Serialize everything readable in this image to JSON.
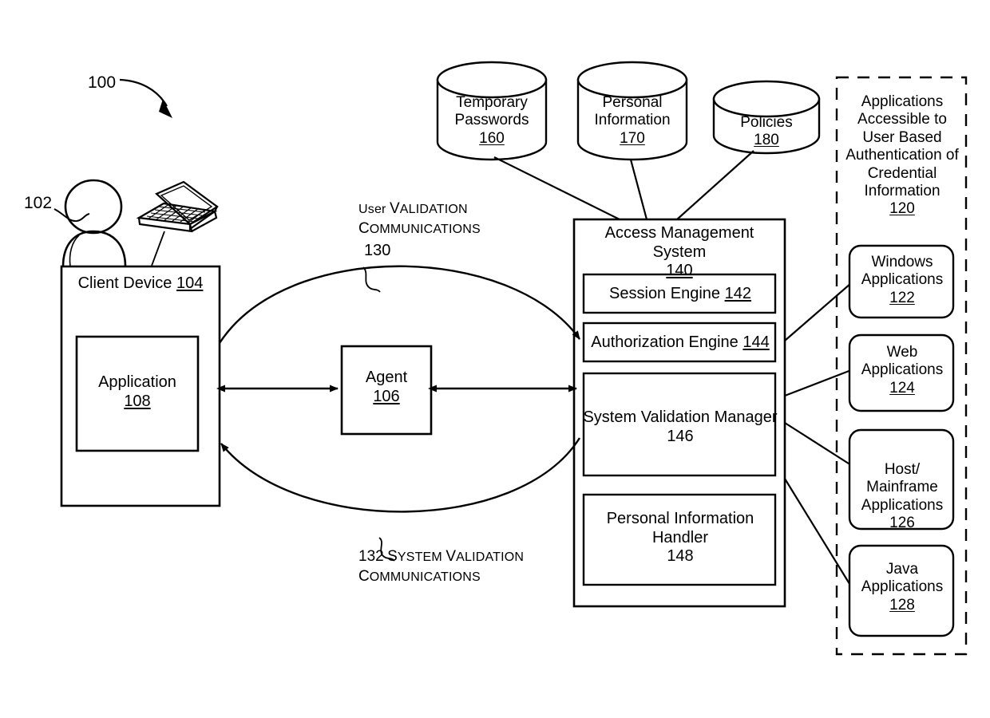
{
  "figure": {
    "number": "100",
    "user_ref": "102"
  },
  "client": {
    "title": "Client Device ",
    "ref": "104",
    "app_name": "Application",
    "app_ref": "108"
  },
  "agent": {
    "name": "Agent",
    "ref": "106"
  },
  "datastores": [
    {
      "name": "Temporary\nPasswords",
      "line1": "Temporary",
      "line2": "Passwords",
      "ref": "160"
    },
    {
      "name": "Personal\nInformation",
      "line1": "Personal",
      "line2": "Information",
      "ref": "170"
    },
    {
      "name": "Policies",
      "line1": "Policies",
      "line2": "",
      "ref": "180"
    }
  ],
  "ams": {
    "title": "Access Management System",
    "ref": "140",
    "components": [
      {
        "label": "Session Engine ",
        "ref": "142",
        "ref_underlined": true
      },
      {
        "label": "Authorization Engine ",
        "ref": "144",
        "ref_underlined": true
      },
      {
        "label": "System Validation Manager",
        "ref": "146",
        "ref_underlined": false
      },
      {
        "label": "Personal Information\nHandler",
        "ref": "148",
        "ref_underlined": false
      }
    ]
  },
  "applications_group": {
    "title": "Applications Accessible to User Based Authentication of Credential Information",
    "ref": "120",
    "items": [
      {
        "label": "Windows\nApplications",
        "ref": "122"
      },
      {
        "label": "Web\nApplications",
        "ref": "124"
      },
      {
        "label": "Host/\nMainframe\nApplications",
        "ref": "126"
      },
      {
        "label": "Java\nApplications",
        "ref": "128"
      }
    ]
  },
  "flows": [
    {
      "ref": "130",
      "first_word": "User",
      "rest": "Validation",
      "second_line": "Communications",
      "ref_position": "after"
    },
    {
      "ref": "132",
      "first_word": "System",
      "rest": "Validation",
      "second_line": "Communications",
      "ref_position": "before"
    }
  ],
  "colors": {
    "stroke": "#000000",
    "background": "#ffffff"
  }
}
